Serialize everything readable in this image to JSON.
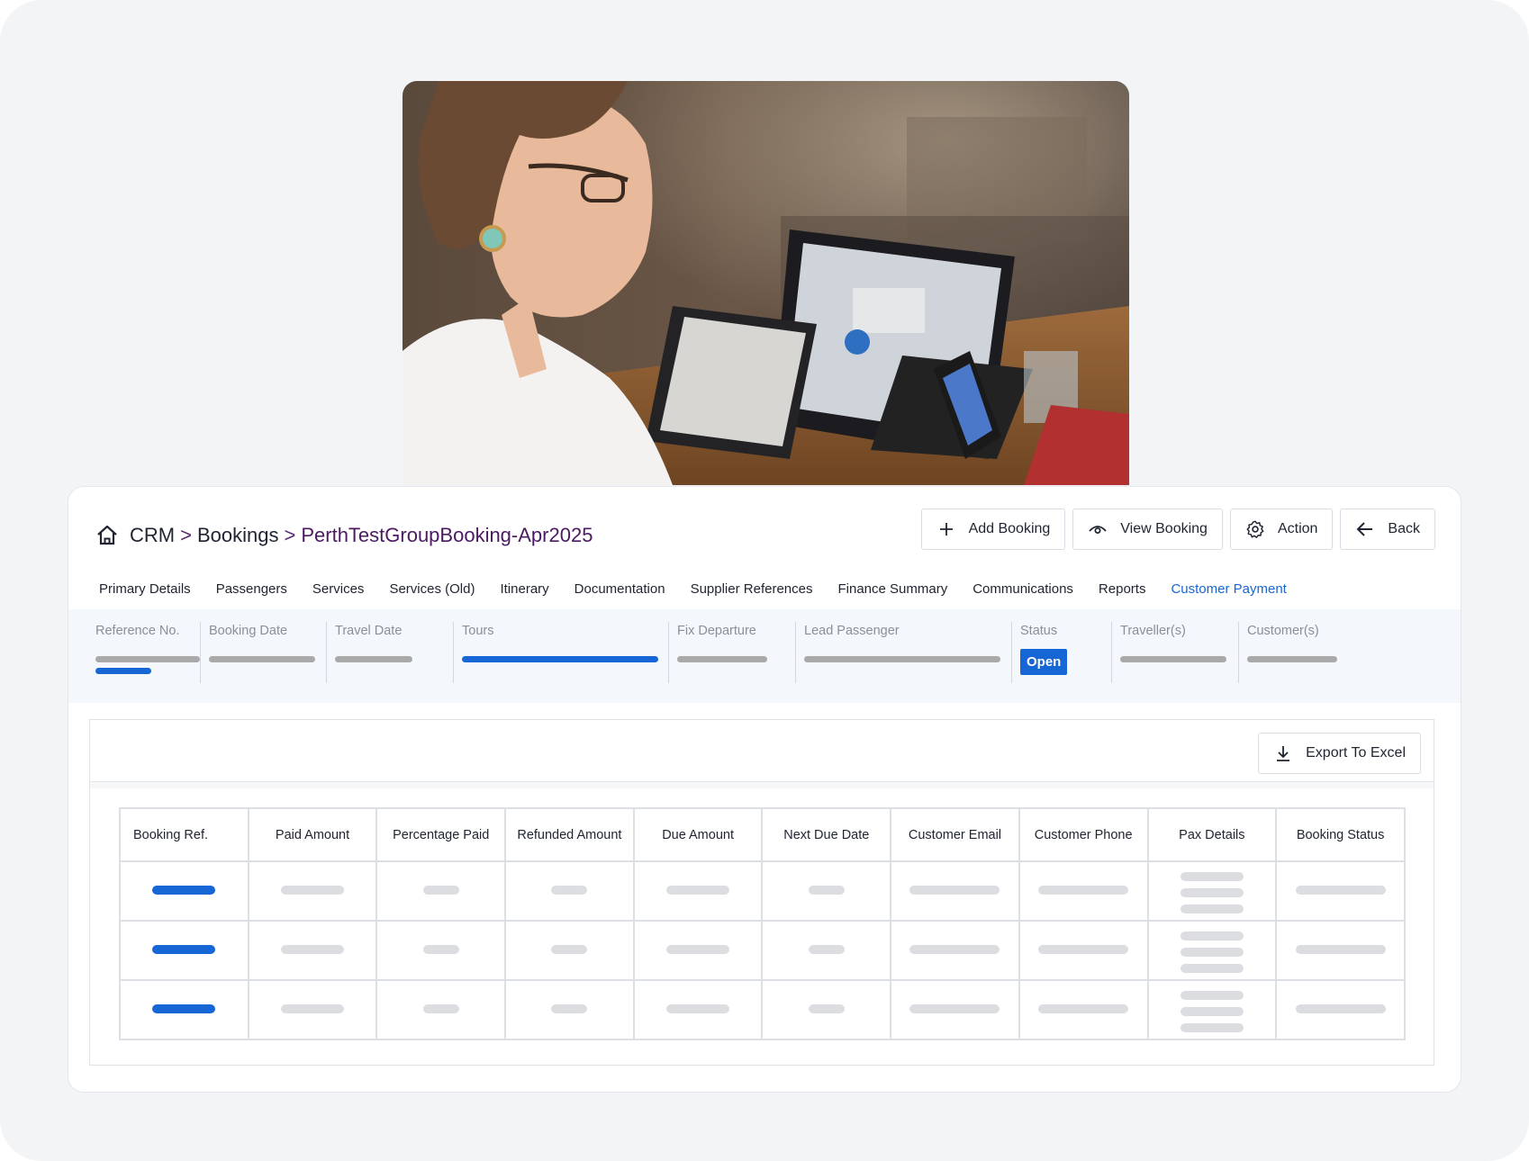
{
  "breadcrumb": {
    "root": "CRM",
    "sep": ">",
    "level2": "Bookings",
    "current": "PerthTestGroupBooking-Apr2025"
  },
  "actions": {
    "add": "Add Booking",
    "view": "View Booking",
    "action": "Action",
    "back": "Back"
  },
  "tabs": [
    {
      "label": "Primary Details"
    },
    {
      "label": "Passengers"
    },
    {
      "label": "Services"
    },
    {
      "label": "Services (Old)"
    },
    {
      "label": "Itinerary"
    },
    {
      "label": "Documentation"
    },
    {
      "label": "Supplier References"
    },
    {
      "label": "Finance Summary"
    },
    {
      "label": "Communications"
    },
    {
      "label": "Reports"
    },
    {
      "label": "Customer Payment",
      "active": true
    }
  ],
  "summary": {
    "reference_no": "Reference No.",
    "booking_date": "Booking Date",
    "travel_date": "Travel Date",
    "tours": "Tours",
    "fix_departure": "Fix Departure",
    "lead_passenger": "Lead Passenger",
    "status": "Status",
    "status_value": "Open",
    "travellers": "Traveller(s)",
    "customers": "Customer(s)"
  },
  "table": {
    "export_label": "Export To Excel",
    "columns": [
      "Booking Ref.",
      "Paid Amount",
      "Percentage Paid",
      "Refunded Amount",
      "Due Amount",
      "Next Due Date",
      "Customer Email",
      "Customer Phone",
      "Pax Details",
      "Booking Status"
    ]
  },
  "colors": {
    "accent": "#1766d6",
    "breadcrumb_current": "#4b1a63",
    "placeholder": "#dcdde1"
  },
  "icons": {
    "home": "home-icon",
    "add": "plus-icon",
    "view": "eye-icon",
    "action": "gear-icon",
    "back": "arrow-left-icon",
    "export": "download-icon"
  }
}
